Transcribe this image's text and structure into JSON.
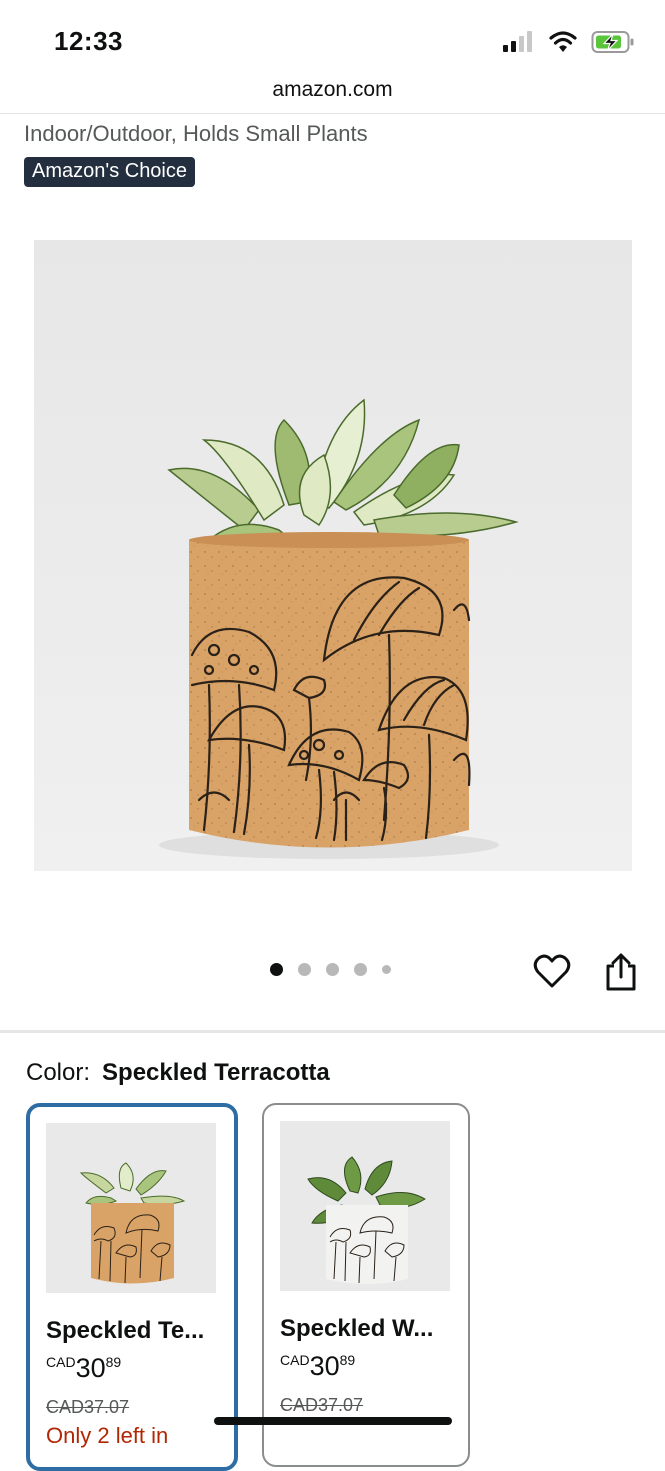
{
  "status_bar": {
    "time": "12:33"
  },
  "browser": {
    "url": "amazon.com"
  },
  "product": {
    "subtitle": "Indoor/Outdoor, Holds Small Plants",
    "badge": "Amazon's Choice",
    "image_icon": "terracotta-mushroom-planter",
    "gallery": {
      "total": 5,
      "active_index": 0
    }
  },
  "actions": {
    "favorite_icon": "heart-icon",
    "share_icon": "share-icon"
  },
  "color_selector": {
    "label": "Color:",
    "selected_value": "Speckled Terracotta",
    "options": [
      {
        "name": "Speckled Te...",
        "currency": "CAD",
        "price_whole": "30",
        "price_fraction": "89",
        "list_price": "CAD37.07",
        "stock": "Only 2 left in",
        "selected": true
      },
      {
        "name": "Speckled W...",
        "currency": "CAD",
        "price_whole": "30",
        "price_fraction": "89",
        "list_price": "CAD37.07",
        "stock": "",
        "selected": false
      }
    ]
  },
  "colors": {
    "badge_bg": "#232f3e",
    "selected_border": "#2e6ca4",
    "stock_red": "#b12704"
  }
}
